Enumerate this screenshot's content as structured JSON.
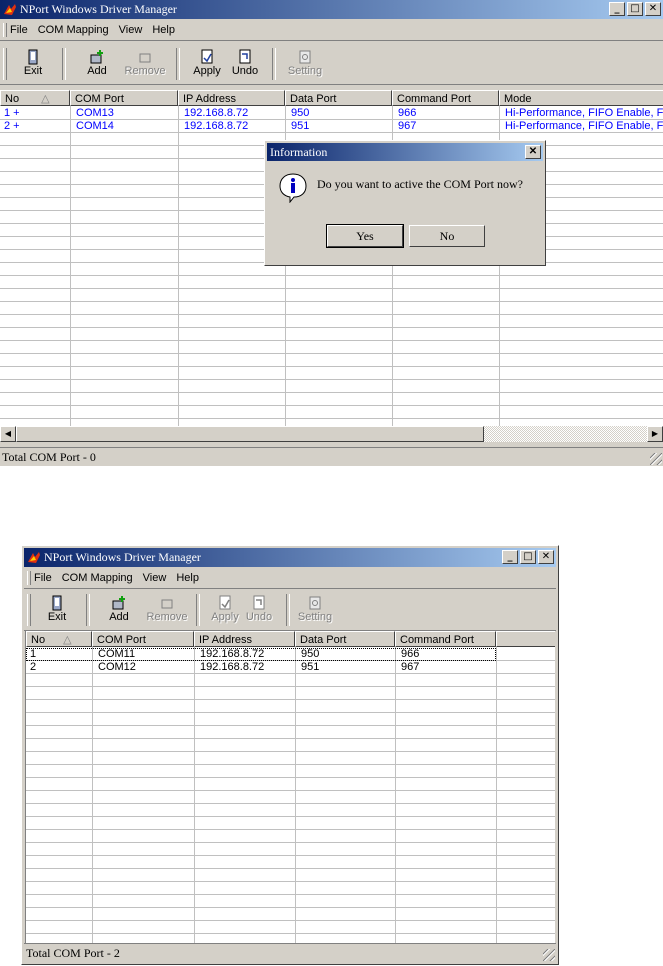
{
  "top": {
    "title": "NPort Windows Driver Manager",
    "menu": [
      "File",
      "COM Mapping",
      "View",
      "Help"
    ],
    "toolbar": {
      "exit": "Exit",
      "add": "Add",
      "remove": "Remove",
      "apply": "Apply",
      "undo": "Undo",
      "setting": "Setting"
    },
    "columns": [
      "No",
      "COM Port",
      "IP Address",
      "Data Port",
      "Command Port",
      "Mode"
    ],
    "rows": [
      [
        "1 +",
        "COM13",
        "192.168.8.72",
        "950",
        "966",
        "Hi-Performance, FIFO Enable, Fa"
      ],
      [
        "2 +",
        "COM14",
        "192.168.8.72",
        "951",
        "967",
        "Hi-Performance, FIFO Enable, Fa"
      ]
    ],
    "status": "Total COM Port - 0",
    "dialog": {
      "title": "Information",
      "message": "Do you want to active the COM Port now?",
      "yes": "Yes",
      "no": "No"
    }
  },
  "bottom": {
    "title": "NPort Windows Driver Manager",
    "menu": [
      "File",
      "COM Mapping",
      "View",
      "Help"
    ],
    "toolbar": {
      "exit": "Exit",
      "add": "Add",
      "remove": "Remove",
      "apply": "Apply",
      "undo": "Undo",
      "setting": "Setting"
    },
    "columns": [
      "No",
      "COM Port",
      "IP Address",
      "Data Port",
      "Command Port"
    ],
    "rows": [
      [
        "1",
        "COM11",
        "192.168.8.72",
        "950",
        "966"
      ],
      [
        "2",
        "COM12",
        "192.168.8.72",
        "951",
        "967"
      ]
    ],
    "status": "Total COM Port - 2"
  },
  "colors": {
    "row_text_top": "#0000ff",
    "title_active": "#0a246a",
    "face": "#d4d0c8"
  }
}
